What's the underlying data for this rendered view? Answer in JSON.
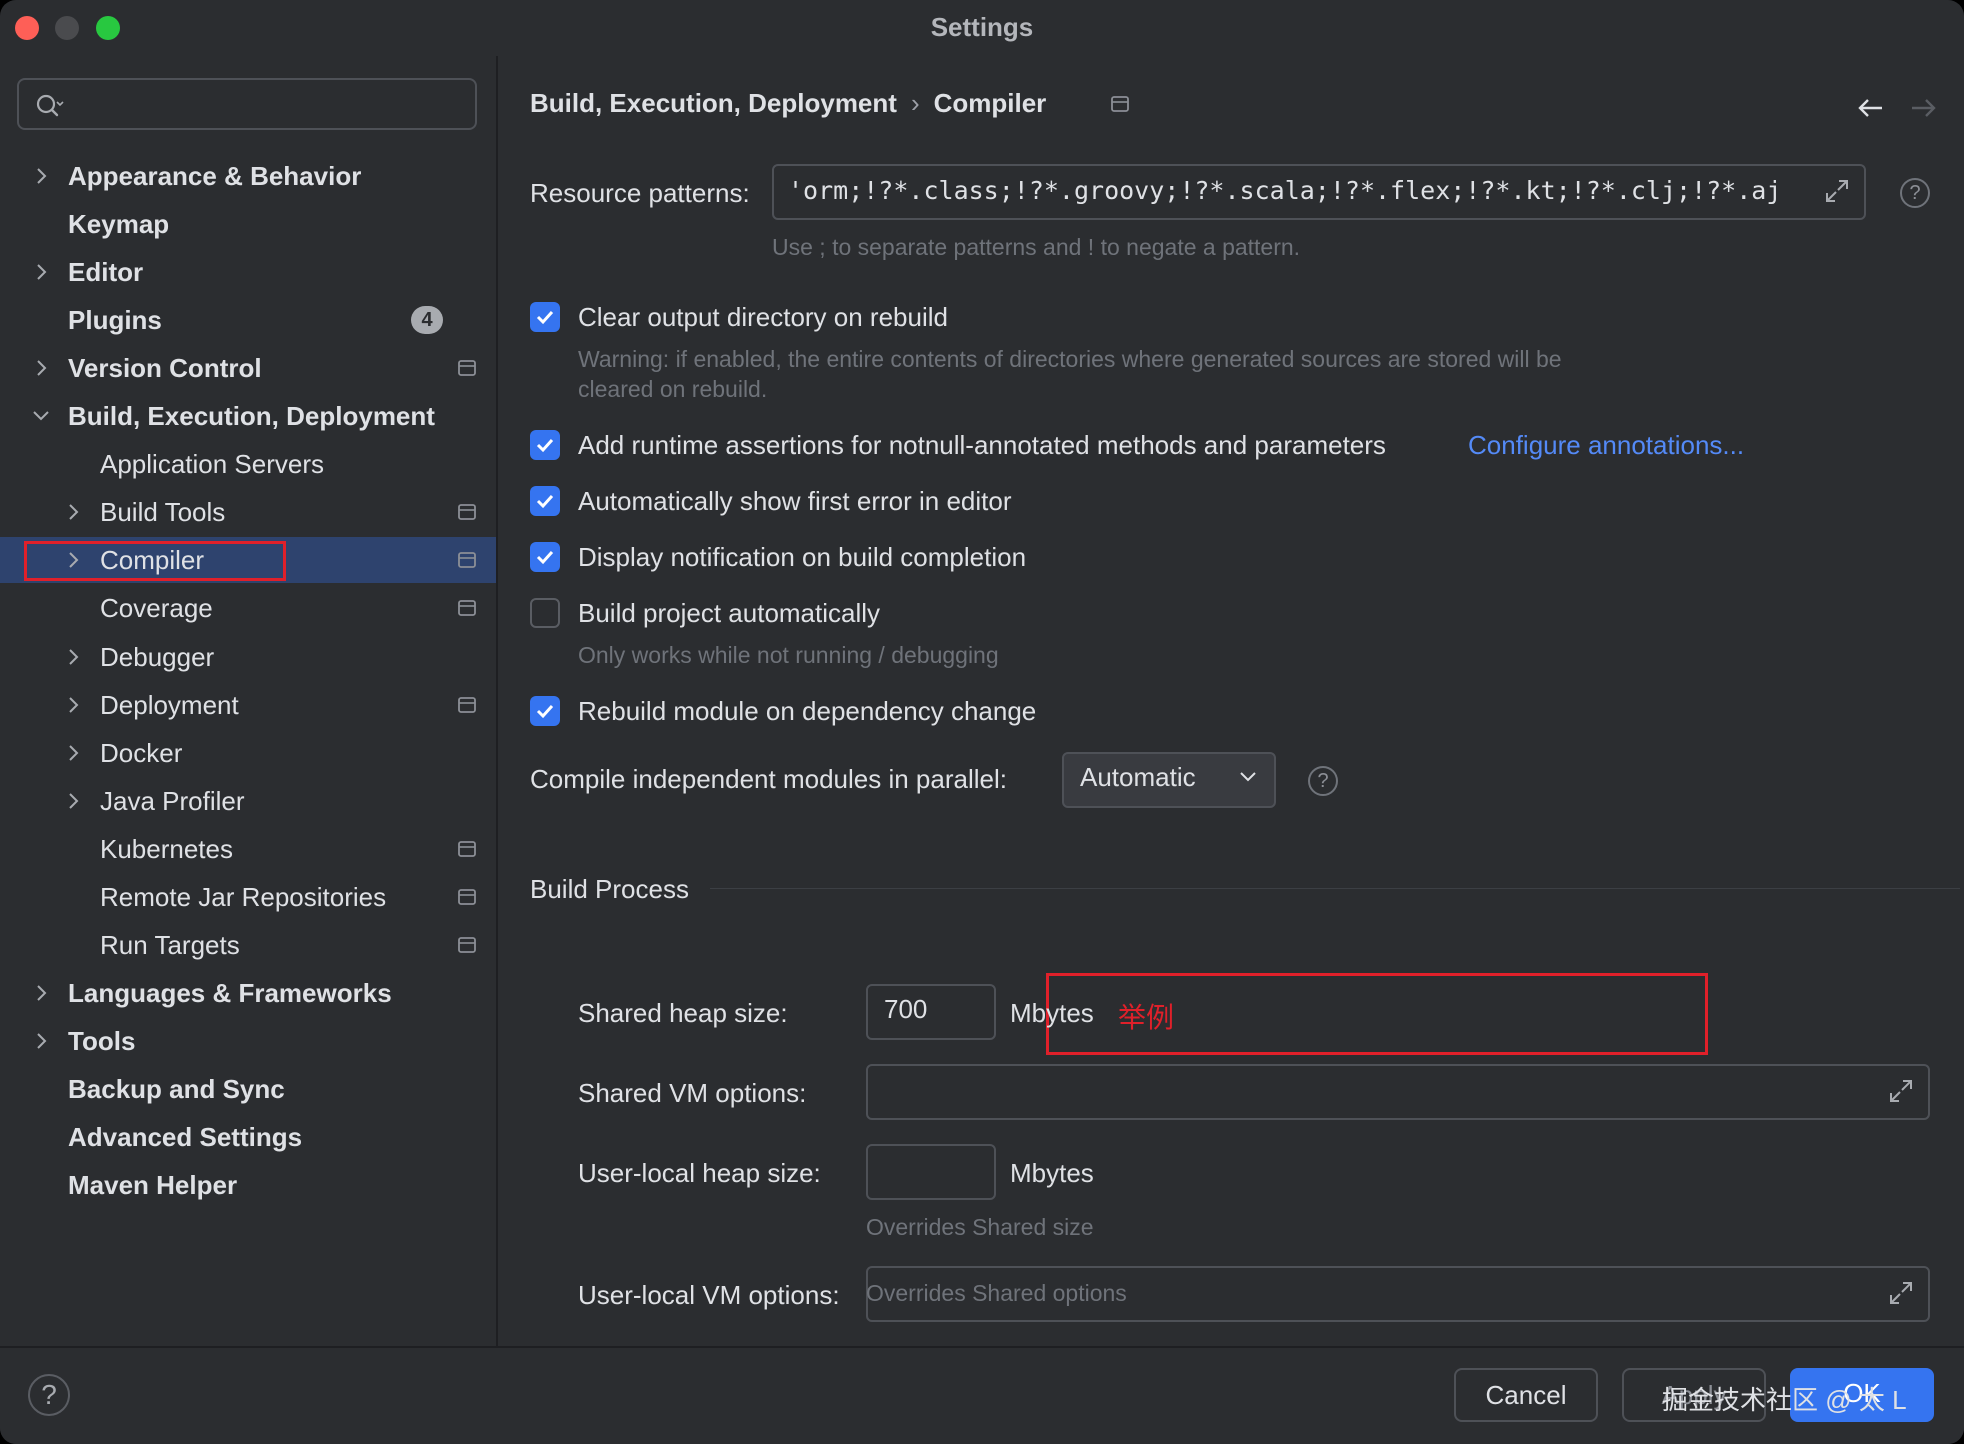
{
  "window": {
    "title": "Settings"
  },
  "sidebar": {
    "search": {
      "placeholder": "",
      "value": ""
    },
    "items": [
      {
        "label": "Appearance & Behavior",
        "level": 0,
        "chevron": "right"
      },
      {
        "label": "Keymap",
        "level": 0,
        "chevron": "none"
      },
      {
        "label": "Editor",
        "level": 0,
        "chevron": "right"
      },
      {
        "label": "Plugins",
        "level": 0,
        "chevron": "none",
        "badge": "4"
      },
      {
        "label": "Version Control",
        "level": 0,
        "chevron": "right",
        "project_icon": true
      },
      {
        "label": "Build, Execution, Deployment",
        "level": 0,
        "chevron": "down"
      },
      {
        "label": "Application Servers",
        "level": 1,
        "chevron": "none"
      },
      {
        "label": "Build Tools",
        "level": 1,
        "chevron": "right",
        "project_icon": true
      },
      {
        "label": "Compiler",
        "level": 1,
        "chevron": "right",
        "project_icon": true,
        "selected": true
      },
      {
        "label": "Coverage",
        "level": 1,
        "chevron": "none",
        "project_icon": true
      },
      {
        "label": "Debugger",
        "level": 1,
        "chevron": "right"
      },
      {
        "label": "Deployment",
        "level": 1,
        "chevron": "right",
        "project_icon": true
      },
      {
        "label": "Docker",
        "level": 1,
        "chevron": "right"
      },
      {
        "label": "Java Profiler",
        "level": 1,
        "chevron": "right"
      },
      {
        "label": "Kubernetes",
        "level": 1,
        "chevron": "none",
        "project_icon": true
      },
      {
        "label": "Remote Jar Repositories",
        "level": 1,
        "chevron": "none",
        "project_icon": true
      },
      {
        "label": "Run Targets",
        "level": 1,
        "chevron": "none",
        "project_icon": true
      },
      {
        "label": "Languages & Frameworks",
        "level": 0,
        "chevron": "right"
      },
      {
        "label": "Tools",
        "level": 0,
        "chevron": "right"
      },
      {
        "label": "Backup and Sync",
        "level": 0,
        "chevron": "none"
      },
      {
        "label": "Advanced Settings",
        "level": 0,
        "chevron": "none"
      },
      {
        "label": "Maven Helper",
        "level": 0,
        "chevron": "none"
      }
    ]
  },
  "main": {
    "breadcrumb": {
      "parent": "Build, Execution, Deployment",
      "separator": "›",
      "current": "Compiler"
    },
    "resource_patterns": {
      "label": "Resource patterns:",
      "value": "'orm;!?*.class;!?*.groovy;!?*.scala;!?*.flex;!?*.kt;!?*.clj;!?*.aj",
      "hint": "Use ; to separate patterns and ! to negate a pattern."
    },
    "options": {
      "clear_output": {
        "label": "Clear output directory on rebuild",
        "checked": true,
        "warning_line1": "Warning: if enabled, the entire contents of directories where generated sources are stored will be",
        "warning_line2": "cleared on rebuild."
      },
      "runtime_assertions": {
        "label": "Add runtime assertions for notnull-annotated methods and parameters",
        "checked": true,
        "link": "Configure annotations..."
      },
      "show_first_error": {
        "label": "Automatically show first error in editor",
        "checked": true
      },
      "notify_completion": {
        "label": "Display notification on build completion",
        "checked": true
      },
      "build_automatically": {
        "label": "Build project automatically",
        "checked": false,
        "hint": "Only works while not running / debugging"
      },
      "rebuild_module": {
        "label": "Rebuild module on dependency change",
        "checked": true
      }
    },
    "parallel": {
      "label": "Compile independent modules in parallel:",
      "value": "Automatic"
    },
    "build_process": {
      "title": "Build Process",
      "shared_heap": {
        "label": "Shared heap size:",
        "value": "700",
        "unit": "Mbytes",
        "note": "举例"
      },
      "shared_vm": {
        "label": "Shared VM options:",
        "value": ""
      },
      "user_heap": {
        "label": "User-local heap size:",
        "value": "",
        "unit": "Mbytes",
        "hint": "Overrides Shared size"
      },
      "user_vm": {
        "label": "User-local VM options:",
        "value": "",
        "hint": "Overrides Shared options"
      }
    }
  },
  "footer": {
    "help": "?",
    "cancel": "Cancel",
    "apply": "Apply",
    "ok": "OK",
    "watermark": "掘金技术社区 @ 太 L"
  },
  "colors": {
    "accent": "#3574f0",
    "link": "#548af7",
    "annotation": "#e0202a",
    "selection": "#2e436e"
  }
}
